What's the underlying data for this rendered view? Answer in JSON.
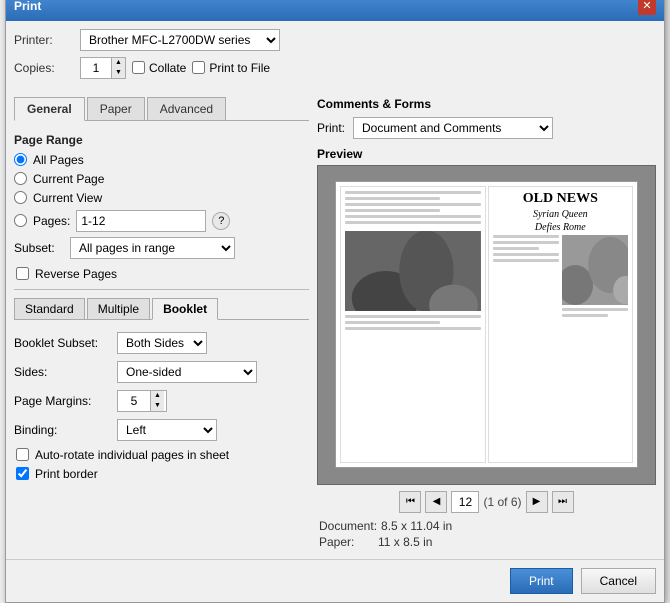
{
  "titleBar": {
    "title": "Print",
    "closeLabel": "✕"
  },
  "printerField": {
    "label": "Printer:",
    "value": "Brother MFC-L2700DW series"
  },
  "copiesField": {
    "label": "Copies:",
    "value": "1"
  },
  "collateLabel": "Collate",
  "printToFileLabel": "Print to File",
  "tabs": {
    "general": "General",
    "paper": "Paper",
    "advanced": "Advanced"
  },
  "pageRange": {
    "title": "Page Range",
    "allPages": "All Pages",
    "currentPage": "Current Page",
    "currentView": "Current View",
    "pagesLabel": "Pages:",
    "pagesValue": "1-12",
    "helpLabel": "?"
  },
  "subset": {
    "label": "Subset:",
    "value": "All pages in range"
  },
  "reversePages": "Reverse Pages",
  "innerTabs": {
    "standard": "Standard",
    "multiple": "Multiple",
    "booklet": "Booklet"
  },
  "booklet": {
    "subsetLabel": "Booklet Subset:",
    "subsetValue": "Both Sides",
    "sidesLabel": "Sides:",
    "sidesValue": "One-sided",
    "marginsLabel": "Page Margins:",
    "marginsValue": "5",
    "bindingLabel": "Binding:",
    "bindingValue": "Left",
    "autoRotate": "Auto-rotate individual pages in sheet",
    "printBorder": "Print border"
  },
  "commentsAndForms": {
    "title": "Comments & Forms",
    "printLabel": "Print:",
    "printValue": "Document and Comments"
  },
  "preview": {
    "label": "Preview",
    "headline": "OLD NEWS",
    "subheadline1": "Syrian Queen",
    "subheadline2": "Defies Rome"
  },
  "navigation": {
    "pageValue": "12",
    "ofLabel": "(1 of 6)"
  },
  "docInfo": {
    "documentLabel": "Document:",
    "documentValue": "8.5 x 11.04 in",
    "paperLabel": "Paper:",
    "paperValue": "11 x 8.5 in"
  },
  "footer": {
    "printLabel": "Print",
    "cancelLabel": "Cancel"
  }
}
